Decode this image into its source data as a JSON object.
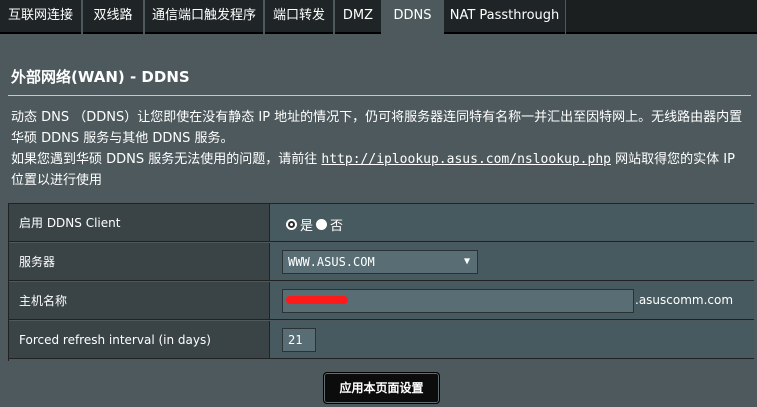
{
  "tabs": [
    {
      "label": "互联网连接",
      "active": false
    },
    {
      "label": "双线路",
      "active": false
    },
    {
      "label": "通信端口触发程序",
      "active": false
    },
    {
      "label": "端口转发",
      "active": false
    },
    {
      "label": "DMZ",
      "active": false
    },
    {
      "label": "DDNS",
      "active": true
    },
    {
      "label": "NAT Passthrough",
      "active": false
    }
  ],
  "page": {
    "title": "外部网络(WAN) - DDNS",
    "desc_line1": "动态 DNS （DDNS）让您即使在没有静态 IP 地址的情况下，仍可将服务器连同特有名称一并汇出至因特网上。无线路由器内置华硕 DDNS 服务与其他 DDNS 服务。",
    "desc_line2_prefix": "如果您遇到华硕 DDNS 服务无法使用的问题，请前往 ",
    "desc_link": "http://iplookup.asus.com/nslookup.php",
    "desc_line2_suffix": " 网站取得您的实体 IP 位置以进行使用"
  },
  "form": {
    "enable_label": "启用 DDNS Client",
    "enable_yes": "是",
    "enable_no": "否",
    "enable_value": "是",
    "server_label": "服务器",
    "server_value": "WWW.ASUS.COM",
    "hostname_label": "主机名称",
    "hostname_value": "",
    "hostname_suffix": ".asuscomm.com",
    "refresh_label": "Forced refresh interval (in days)",
    "refresh_value": "21"
  },
  "apply_label": "应用本页面设置",
  "icons": {
    "select_chevron": "chevron-down-icon",
    "radio": "radio-icon"
  },
  "colors": {
    "background": "#4d595d",
    "tab_inactive": "#1f2426",
    "table_header": "#3a4447",
    "table_cell": "#475a5f",
    "redaction": "#ff1a1a"
  }
}
